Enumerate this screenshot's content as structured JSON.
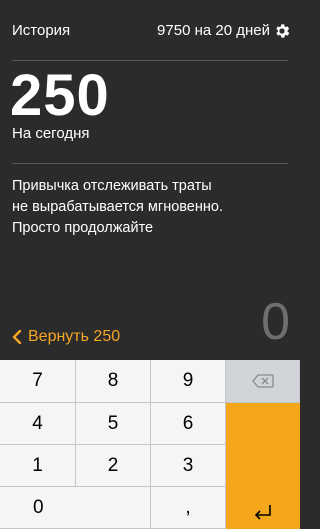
{
  "header": {
    "history_label": "История",
    "budget_text": "9750 на 20 дней",
    "settings_icon": "gear-icon"
  },
  "summary": {
    "amount": "250",
    "caption": "На сегодня"
  },
  "message": {
    "lines": [
      "Привычка отслеживать траты",
      "не вырабатывается мгновенно.",
      "Просто продолжайте"
    ]
  },
  "actions": {
    "return_label": "Вернуть 250",
    "return_icon": "chevron-left-icon"
  },
  "input": {
    "value": "0"
  },
  "keypad": {
    "row1": [
      "7",
      "8",
      "9"
    ],
    "row2": [
      "4",
      "5",
      "6"
    ],
    "row3": [
      "1",
      "2",
      "3"
    ],
    "zero": "0",
    "comma": ",",
    "backspace_icon": "backspace-icon",
    "enter_icon": "enter-icon"
  },
  "colors": {
    "background": "#2b2b2b",
    "accent": "#f5a623",
    "keypad": "#d1d4d9",
    "key": "#f5f5f5"
  }
}
